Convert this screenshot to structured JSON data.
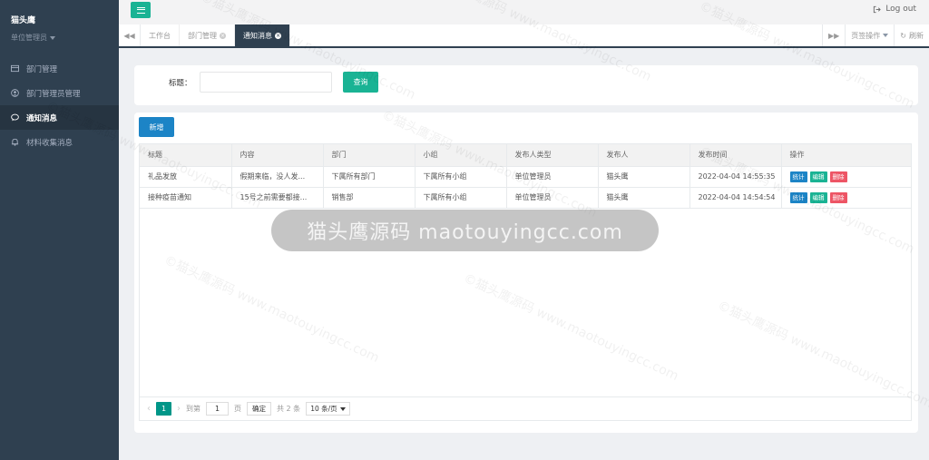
{
  "sidebar": {
    "brand_name": "猫头鹰",
    "role": "单位管理员",
    "items": [
      {
        "label": "部门管理",
        "icon": "table-icon"
      },
      {
        "label": "部门管理员管理",
        "icon": "user-circle-icon"
      },
      {
        "label": "通知消息",
        "icon": "comment-icon"
      },
      {
        "label": "材料收集消息",
        "icon": "bell-icon"
      }
    ]
  },
  "topbar": {
    "logout_label": "Log out"
  },
  "tabs": {
    "items": [
      {
        "label": "工作台"
      },
      {
        "label": "部门管理"
      },
      {
        "label": "通知消息"
      }
    ],
    "page_ops_label": "页签操作",
    "refresh_label": "刷新"
  },
  "search": {
    "title_label": "标题：",
    "title_value": "",
    "query_button": "查询"
  },
  "toolbar": {
    "add_button": "新增"
  },
  "table": {
    "columns": [
      "标题",
      "内容",
      "部门",
      "小组",
      "发布人类型",
      "发布人",
      "发布时间",
      "操作"
    ],
    "rows": [
      {
        "title": "礼品发放",
        "content": "假期来临，没人发...",
        "dept": "下属所有部门",
        "group": "下属所有小组",
        "publisher_type": "单位管理员",
        "publisher": "猫头鹰",
        "time": "2022-04-04 14:55:35"
      },
      {
        "title": "接种疫苗通知",
        "content": "15号之前需要都接...",
        "dept": "销售部",
        "group": "下属所有小组",
        "publisher_type": "单位管理员",
        "publisher": "猫头鹰",
        "time": "2022-04-04 14:54:54"
      }
    ],
    "actions": {
      "stat": "统计",
      "edit": "编辑",
      "delete": "删除"
    }
  },
  "pager": {
    "current_page": "1",
    "goto_label": "到第",
    "goto_value": "1",
    "page_label": "页",
    "confirm_label": "确定",
    "total_label": "共 2 条",
    "page_size": "10 条/页"
  },
  "watermark": {
    "text_cn": "©猫头鹰源码",
    "text_url": "www.maotouyingcc.com",
    "banner": "猫头鹰源码 maotouyingcc.com"
  }
}
